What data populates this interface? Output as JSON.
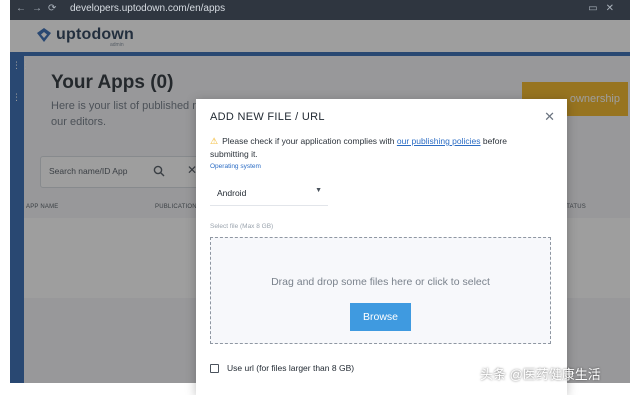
{
  "browser": {
    "url": "developers.uptodown.com/en/apps",
    "nav_glyphs": "←→⟳",
    "window_glyphs": "▭✕"
  },
  "app": {
    "brand": "uptodown",
    "brand_sub": "admin",
    "page_title": "Your Apps (0)",
    "page_subtitle": "Here is your list of published review by our editors.",
    "ownership_button": "ownership",
    "search_placeholder": "Search name/ID App",
    "columns": [
      "APP NAME",
      "PUBLICATION",
      "STATUS"
    ]
  },
  "modal": {
    "title": "ADD NEW FILE / URL",
    "warning_prefix": "Please check if your application complies with ",
    "warning_link": "our publishing policies",
    "warning_suffix": " before submitting it.",
    "os_label": "Operating system",
    "os_value": "Android",
    "file_label": "Select file (Max 8 GB)",
    "drop_text": "Drag and drop some files here or click to select",
    "browse_label": "Browse",
    "url_label": "Use url (for files larger than 8 GB)"
  },
  "watermark": "头条 @医药健康生活",
  "colors": {
    "accent_blue": "#2b63b0",
    "link_blue": "#2b6cc4",
    "button_blue": "#3f9ae0",
    "warning_yellow": "#f2b21a"
  },
  "icons": [
    "back-icon",
    "search-icon",
    "clear-icon",
    "warning-icon",
    "close-icon",
    "chevron-down-icon",
    "checkbox-icon",
    "grid-icon"
  ]
}
